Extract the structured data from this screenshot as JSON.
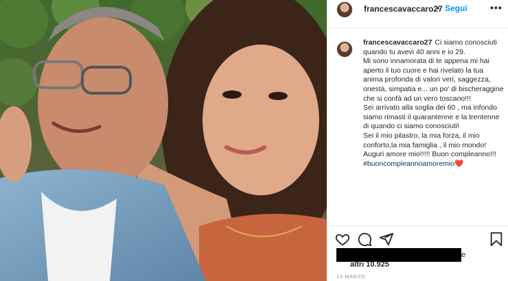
{
  "post": {
    "username": "francescavaccaro27",
    "follow_label": "Segui",
    "separator": "•",
    "more_icon": "•••",
    "caption": {
      "username": "francescavaccaro27",
      "lines": [
        "Ci siamo conosciuti quando tu avevi 40 anni e io 29.",
        "Mi sono innamorata di te appena mi hai aperto il tuo cuore e hai rivelato la tua anima profonda di valori veri, saggezza, onestà, simpatia e... un po' di bischeraggine che si confà ad un vero toscano!!!",
        "Sei arrivato alla soglia dei 60 , ma infondo siamo rimasti il quarantenne e la trentenne di quando ci siamo conosciuti!",
        "Sei il mio pilastro, la mia forza, il mio conforto,la mia famiglia , il mio mondo!",
        "Auguri amore mio!!!!! Buon compleanno!!!"
      ],
      "hashtag": "#buoncompleannoamoremio",
      "heart": "❤️"
    },
    "likes": {
      "suffix": "e",
      "others": "altri 10.925"
    },
    "date": "13 MARZO"
  },
  "icons": {
    "like": "heart-outline-icon",
    "comment": "comment-bubble-icon",
    "share": "paper-plane-icon",
    "save": "bookmark-icon",
    "more": "ellipsis-icon"
  },
  "colors": {
    "follow": "#0095f6",
    "hashtag": "#00376b",
    "text": "#262626",
    "muted": "#8e8e8e",
    "heart": "#ed4956"
  }
}
